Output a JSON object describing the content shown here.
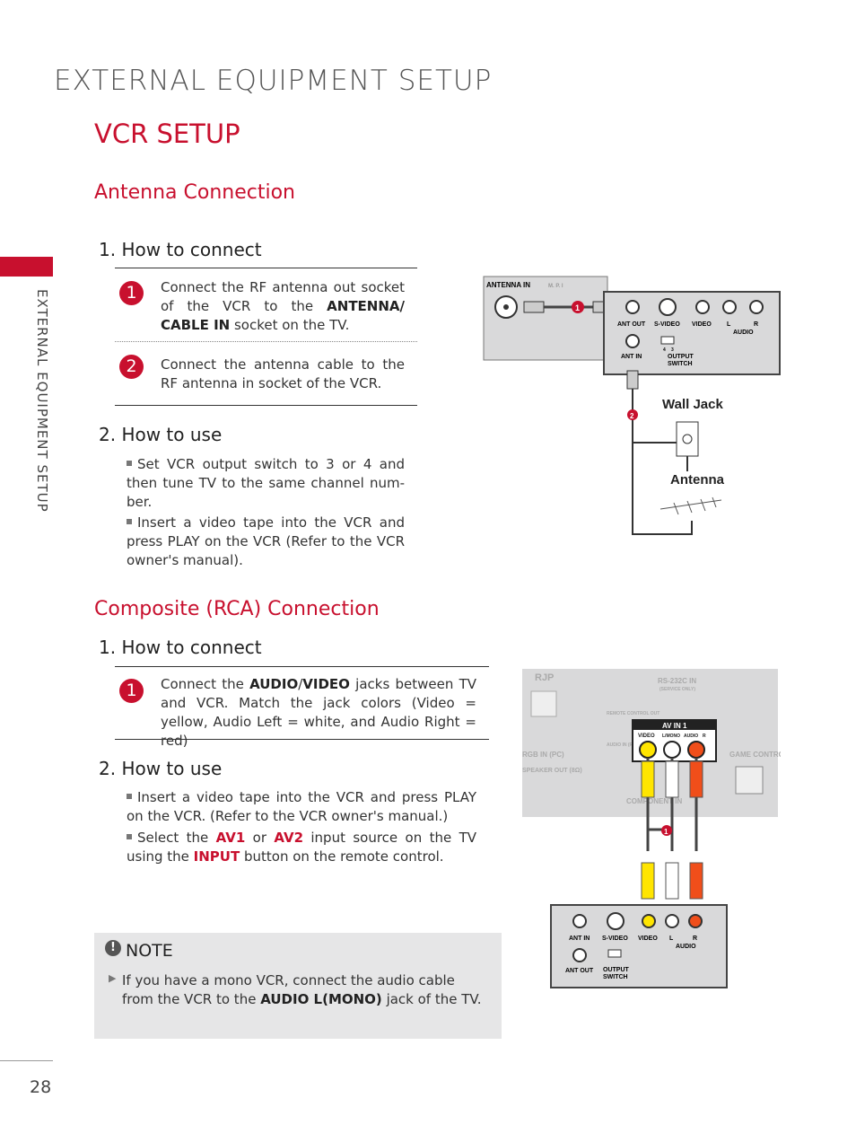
{
  "header": {
    "title": "EXTERNAL EQUIPMENT SETUP",
    "subtitle": "VCR SETUP"
  },
  "sidebar": {
    "label": "EXTERNAL EQUIPMENT SETUP"
  },
  "antenna": {
    "title": "Antenna Connection",
    "connect_heading": "1. How to connect",
    "steps": [
      {
        "num": "1",
        "pre": "Connect the RF antenna out socket of the VCR to the ",
        "bold": "ANTENNA/ CABLE IN",
        "post": " socket on the TV."
      },
      {
        "num": "2",
        "text": "Connect the antenna cable to the RF antenna in socket of the VCR."
      }
    ],
    "use_heading": "2. How to use",
    "use_items": [
      "Set VCR output switch to 3 or 4 and then tune TV to the same channel num-ber.",
      "Insert a video tape into the VCR and press PLAY on the VCR (Refer to the VCR owner's manual)."
    ],
    "diagram": {
      "tv_label": "ANTENNA IN",
      "mpi": "M. P. I",
      "ant_out": "ANT OUT",
      "svideo": "S-VIDEO",
      "video": "VIDEO",
      "audio": "AUDIO",
      "l": "L",
      "r": "R",
      "ant_in": "ANT IN",
      "output_switch_1": "OUTPUT",
      "output_switch_2": "SWITCH",
      "sw4": "4",
      "sw3": "3",
      "wall_jack": "Wall Jack",
      "antenna": "Antenna",
      "marker1": "1",
      "marker2": "2"
    }
  },
  "composite": {
    "title": "Composite (RCA) Connection",
    "connect_heading": "1. How to connect",
    "step": {
      "num": "1",
      "pre": "Connect the ",
      "bold1": "AUDIO",
      "slash": "/",
      "bold2": "VIDEO",
      "post": " jacks between TV and VCR. Match the jack colors (Video = yellow, Audio Left = white, and Audio Right = red)"
    },
    "use_heading": "2. How to use",
    "use_items": [
      {
        "text": "Insert a video tape into the VCR and press PLAY on the VCR. (Refer to the VCR owner's manual.)"
      },
      {
        "p1": "Select the ",
        "av1": "AV1",
        "p2": " or ",
        "av2": "AV2",
        "p3": " input source on the TV using the ",
        "input": "INPUT",
        "p4": " button on the remote control."
      }
    ],
    "diagram": {
      "rjp": "RJP",
      "rs232": "RS-232C IN",
      "service": "(SERVICE ONLY)",
      "remote": "REMOTE CONTROL OUT",
      "audio_in": "AUDIO IN (RGB/DVI)",
      "rgb": "RGB IN (PC)",
      "speaker": "SPEAKER OUT (8Ω)",
      "av_in": "AV IN 1",
      "video": "VIDEO",
      "lmono": "L/MONO",
      "audio": "AUDIO",
      "r": "R",
      "component": "COMPONENT IN",
      "game": "GAME CONTROL",
      "marker1": "1",
      "ant_in": "ANT IN",
      "svideo": "S-VIDEO",
      "vcr_video": "VIDEO",
      "vcr_audio": "AUDIO",
      "l": "L",
      "ant_out": "ANT OUT",
      "output": "OUTPUT",
      "switch": "SWITCH"
    },
    "colors": {
      "yellow": "#ffe500",
      "white": "#ffffff",
      "red": "#f04e1a",
      "accent": "#c8102e"
    }
  },
  "note": {
    "title": "NOTE",
    "pre": "If you have a mono VCR, connect the audio cable from the VCR to the ",
    "bold": "AUDIO L(MONO)",
    "post": " jack of the TV."
  },
  "page_number": "28"
}
